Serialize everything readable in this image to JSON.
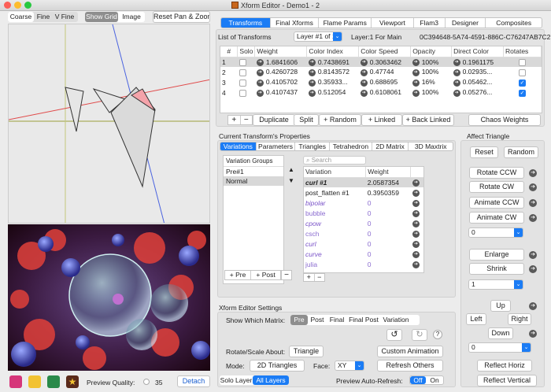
{
  "window": {
    "title": "Xform Editor - Demo1 - 2"
  },
  "canvas_toolbar": {
    "modes": [
      "Coarse",
      "Fine",
      "V Fine"
    ],
    "show_grid": "Show Grid",
    "image": "Image",
    "reset": "Reset Pan & Zoom"
  },
  "top_tabs": [
    "Transforms",
    "Final Xforms",
    "Flame Params",
    "Viewport",
    "Flam3",
    "Designer",
    "Composites"
  ],
  "transforms": {
    "list_label": "List of Transforms",
    "layer_select": "Layer #1 of 1",
    "layer_info": "Layer:1 For Main",
    "uuid": "0C394648-5A74-4591-886C-C76247AB7C2D",
    "columns": [
      "#",
      "Solo",
      "Weight",
      "Color Index",
      "Color Speed",
      "Opacity",
      "Direct Color",
      "Rotates"
    ],
    "rows": [
      {
        "num": "1",
        "weight": "1.6841606",
        "color_index": "0.7438691",
        "color_speed": "0.3063462",
        "opacity": "100%",
        "direct_color": "0.1961175",
        "rotates": false
      },
      {
        "num": "2",
        "weight": "0.4260728",
        "color_index": "0.8143572",
        "color_speed": "0.47744",
        "opacity": "100%",
        "direct_color": "0.02935...",
        "rotates": false
      },
      {
        "num": "3",
        "weight": "0.4105702",
        "color_index": "0.35933...",
        "color_speed": "0.688695",
        "opacity": "16%",
        "direct_color": "0.05462...",
        "rotates": true
      },
      {
        "num": "4",
        "weight": "0.4107437",
        "color_index": "0.512054",
        "color_speed": "0.6108061",
        "opacity": "100%",
        "direct_color": "0.05276...",
        "rotates": true
      }
    ],
    "buttons": [
      "Duplicate",
      "Split",
      "+ Random",
      "+ Linked",
      "+ Back Linked",
      "Chaos Weights"
    ]
  },
  "properties": {
    "title": "Current Transform's Properties",
    "tabs": [
      "Variations",
      "Parameters",
      "Triangles",
      "Tetrahedron",
      "2D Matrix",
      "3D Maxtrix"
    ],
    "groups_header": "Variation Groups",
    "groups": [
      "Pre#1",
      "Normal"
    ],
    "pre_btn": "Pre",
    "post_btn": "Post",
    "search_placeholder": "Search",
    "var_col": "Variation",
    "weight_col": "Weight",
    "variations": [
      {
        "name": "curl #1",
        "weight": "2.0587354",
        "style": "bold"
      },
      {
        "name": "post_flatten #1",
        "weight": "0.3950359",
        "style": "normal"
      },
      {
        "name": "bipolar",
        "weight": "0",
        "style": "purple"
      },
      {
        "name": "bubble",
        "weight": "0",
        "style": "light"
      },
      {
        "name": "cpow",
        "weight": "0",
        "style": "purple"
      },
      {
        "name": "csch",
        "weight": "0",
        "style": "light"
      },
      {
        "name": "curl",
        "weight": "0",
        "style": "purple"
      },
      {
        "name": "curve",
        "weight": "0",
        "style": "purple"
      },
      {
        "name": "julia",
        "weight": "0",
        "style": "light"
      }
    ]
  },
  "affect": {
    "title": "Affect Triangle",
    "reset": "Reset",
    "random": "Random",
    "rotate_ccw": "Rotate CCW",
    "rotate_cw": "Rotate CW",
    "animate_ccw": "Animate CCW",
    "animate_cw": "Animate CW",
    "angle": "0",
    "enlarge": "Enlarge",
    "shrink": "Shrink",
    "scale": "1",
    "up": "Up",
    "left": "Left",
    "right": "Right",
    "down": "Down",
    "move": "0",
    "reflect_horiz": "Reflect Horiz",
    "reflect_vertical": "Reflect Vertical"
  },
  "settings": {
    "title": "Xform Editor Settings",
    "matrix_label": "Show Which Matrix:",
    "matrix_options": [
      "Pre",
      "Post",
      "Final",
      "Final Post",
      "Variation"
    ],
    "rotate_label": "Rotate/Scale About:",
    "rotate_value": "Triangle",
    "custom_anim": "Custom Animation",
    "mode_label": "Mode:",
    "mode_value": "2D Triangles",
    "face_label": "Face:",
    "face_value": "XY",
    "refresh": "Refresh Others",
    "layer_opts": [
      "Solo Layer",
      "All Layers"
    ],
    "auto_refresh_label": "Preview Auto-Refresh:",
    "auto_refresh": [
      "Off",
      "On"
    ],
    "help": "?"
  },
  "preview": {
    "quality_label": "Preview Quality:",
    "quality_value": "35",
    "detach": "Detach"
  },
  "colors": {
    "accent": "#1b7cf5"
  }
}
